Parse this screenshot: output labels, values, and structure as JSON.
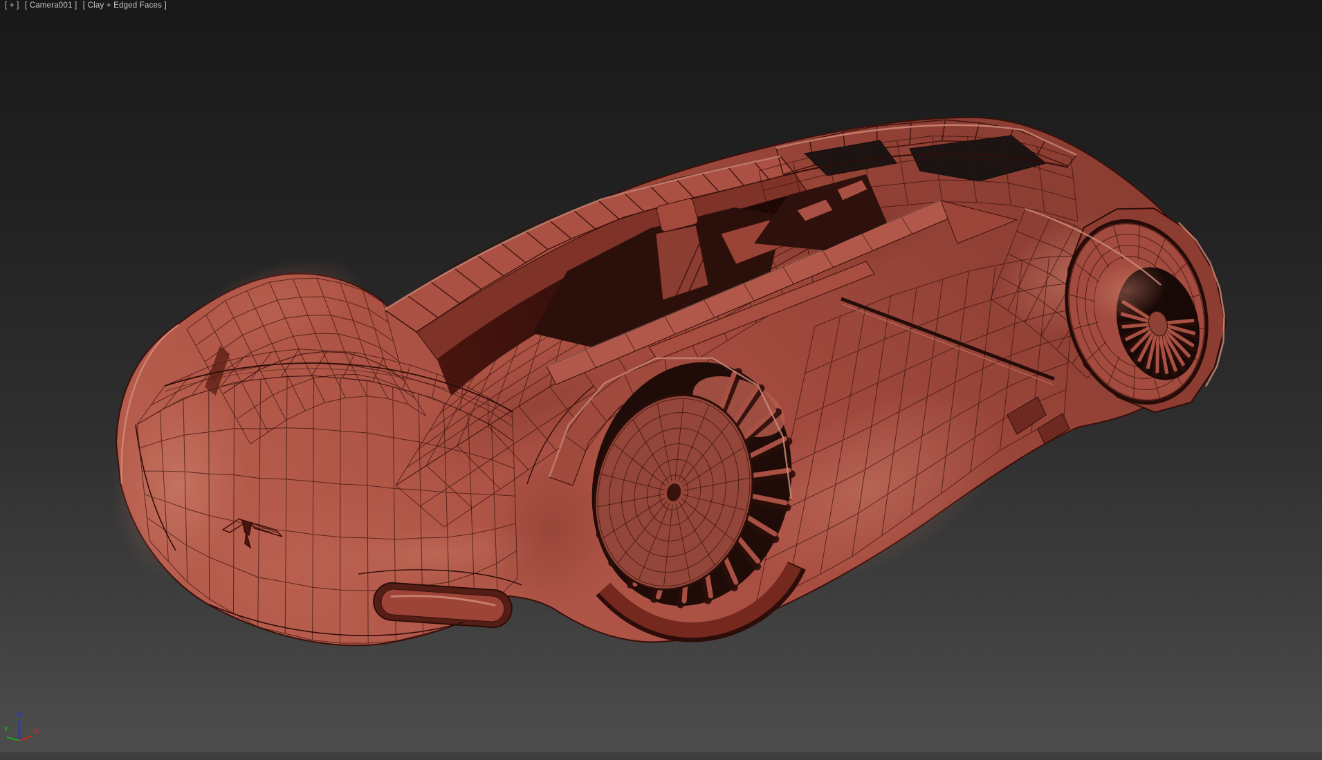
{
  "viewport": {
    "label_segments": [
      {
        "id": "pov-menu",
        "text": "[ + ]"
      },
      {
        "id": "camera-menu",
        "text": "[ Camera001 ]"
      },
      {
        "id": "shading-menu",
        "text": "[ Clay + Edged Faces ]"
      }
    ]
  },
  "axis_gizmo": {
    "x_label": "X",
    "y_label": "Y",
    "z_label": "Z"
  },
  "scene": {
    "object_semantic": "futuristic-concept-car-clay-wireframe-model"
  },
  "colors": {
    "bg_top": "#181818",
    "bg_mid": "#2e2e2e",
    "bg_bottom": "#4b4b4b",
    "bg_strip": "#3e3e3e",
    "label_text": "#c8c8c8",
    "clay": "#a6493d",
    "clay_hi": "#c87a68",
    "clay_lo": "#8f4034",
    "clay_deep": "#5e2018",
    "wire": "#38100b",
    "cavity": "#1f0c08",
    "opening": "#1c1413",
    "liner": "#b45a4a",
    "blade": "#a85043",
    "rim_light": "#d5907c",
    "axis_x": "#bd2c20",
    "axis_y": "#23a423",
    "axis_z": "#2a35cc"
  }
}
